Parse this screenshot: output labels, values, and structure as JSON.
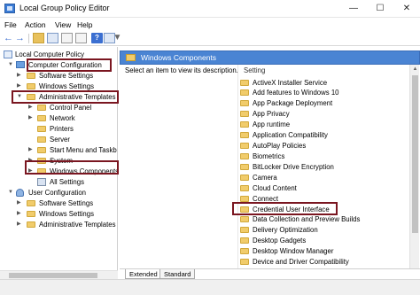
{
  "window": {
    "title": "Local Group Policy Editor"
  },
  "menu": [
    "File",
    "Action",
    "View",
    "Help"
  ],
  "tree": {
    "root": "Local Computer Policy",
    "computer_configuration": "Computer Configuration",
    "software_settings": "Software Settings",
    "windows_settings": "Windows Settings",
    "administrative_templates": "Administrative Templates",
    "control_panel": "Control Panel",
    "network": "Network",
    "printers": "Printers",
    "server": "Server",
    "start_menu": "Start Menu and Taskbar",
    "system": "System",
    "windows_components": "Windows Components",
    "all_settings": "All Settings",
    "user_configuration": "User Configuration",
    "user_software_settings": "Software Settings",
    "user_windows_settings": "Windows Settings",
    "user_administrative_templates": "Administrative Templates"
  },
  "details": {
    "header": "Windows Components",
    "description": "Select an item to view its description.",
    "column_header": "Setting",
    "items": [
      "ActiveX Installer Service",
      "Add features to Windows 10",
      "App Package Deployment",
      "App Privacy",
      "App runtime",
      "Application Compatibility",
      "AutoPlay Policies",
      "Biometrics",
      "BitLocker Drive Encryption",
      "Camera",
      "Cloud Content",
      "Connect",
      "Credential User Interface",
      "Data Collection and Preview Builds",
      "Delivery Optimization",
      "Desktop Gadgets",
      "Desktop Window Manager",
      "Device and Driver Compatibility"
    ]
  },
  "tabs": {
    "extended": "Extended",
    "standard": "Standard"
  },
  "colors": {
    "header_blue": "#4a84d3",
    "highlight_border": "#7a1620",
    "folder": "#f1cc6b"
  }
}
